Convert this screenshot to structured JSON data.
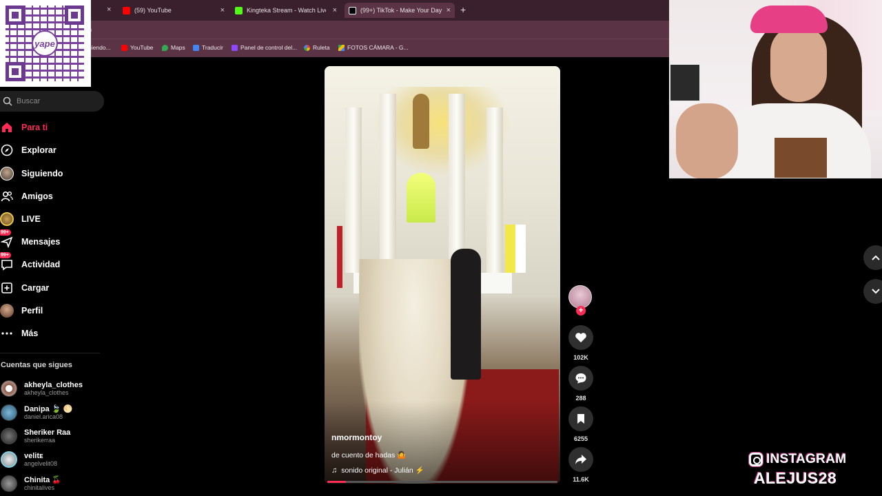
{
  "browser": {
    "tabs": [
      {
        "label": "(59) YouTube",
        "icon": "youtube-icon",
        "color": "#ff0000"
      },
      {
        "label": "Kingteka Stream - Watch Live o",
        "icon": "kick-icon",
        "color": "#53fc18"
      },
      {
        "label": "(99+) TikTok - Make Your Day",
        "icon": "tiktok-icon",
        "color": "#000000"
      }
    ],
    "new_tab_label": "+",
    "close_label": "×",
    "address_fragment": "n",
    "bookmarks": [
      {
        "label": "uiendo...",
        "icon": "bookmark-icon",
        "color": "#888888"
      },
      {
        "label": "YouTube",
        "icon": "youtube-icon",
        "color": "#ff0000"
      },
      {
        "label": "Maps",
        "icon": "maps-icon",
        "color": "#34a853"
      },
      {
        "label": "Traducir",
        "icon": "translate-icon",
        "color": "#4285f4"
      },
      {
        "label": "Panel de control del...",
        "icon": "twitch-icon",
        "color": "#9146ff"
      },
      {
        "label": "Ruleta",
        "icon": "roulette-icon",
        "color": "#ea4335"
      },
      {
        "label": "FOTOS CÁMARA - G...",
        "icon": "drive-icon",
        "color": "#fbbc04"
      }
    ]
  },
  "qr": {
    "brand": "yape",
    "color": "#6a2c91"
  },
  "sidebar": {
    "search_placeholder": "Buscar",
    "nav": [
      {
        "label": "Para ti",
        "icon": "home-icon",
        "active": true
      },
      {
        "label": "Explorar",
        "icon": "compass-icon"
      },
      {
        "label": "Siguiendo",
        "icon": "following-avatar-icon"
      },
      {
        "label": "Amigos",
        "icon": "friends-icon"
      },
      {
        "label": "LIVE",
        "icon": "live-icon"
      },
      {
        "label": "Mensajes",
        "icon": "messages-icon",
        "badge": "99+"
      },
      {
        "label": "Actividad",
        "icon": "activity-icon",
        "badge": "99+"
      },
      {
        "label": "Cargar",
        "icon": "upload-icon"
      },
      {
        "label": "Perfil",
        "icon": "profile-icon"
      },
      {
        "label": "Más",
        "icon": "more-icon"
      }
    ],
    "following_title": "Cuentas que sigues",
    "following": [
      {
        "name": "akheyla_clothes",
        "handle": "akheyla_clothes"
      },
      {
        "name": "Danipa 🍃 🌕",
        "handle": "daniel.arica08"
      },
      {
        "name": "Sheriker Raa",
        "handle": "sherikerraa"
      },
      {
        "name": "velitᴇ",
        "handle": "angelvelit08"
      },
      {
        "name": "Chinita 🍒",
        "handle": "chinitalives"
      }
    ]
  },
  "video": {
    "author": "nmormontoy",
    "caption": "de cuento de hadas 🤷",
    "music": "sonido original - Julián ⚡",
    "progress": 0.08
  },
  "actions": {
    "likes": "102K",
    "comments": "288",
    "saves": "6255",
    "shares": "11.6K"
  },
  "overlay": {
    "instagram_label": "INSTAGRAM",
    "instagram_user": "ALEJUS28"
  },
  "colors": {
    "accent": "#fe2c55",
    "chrome": "#5a3344"
  }
}
